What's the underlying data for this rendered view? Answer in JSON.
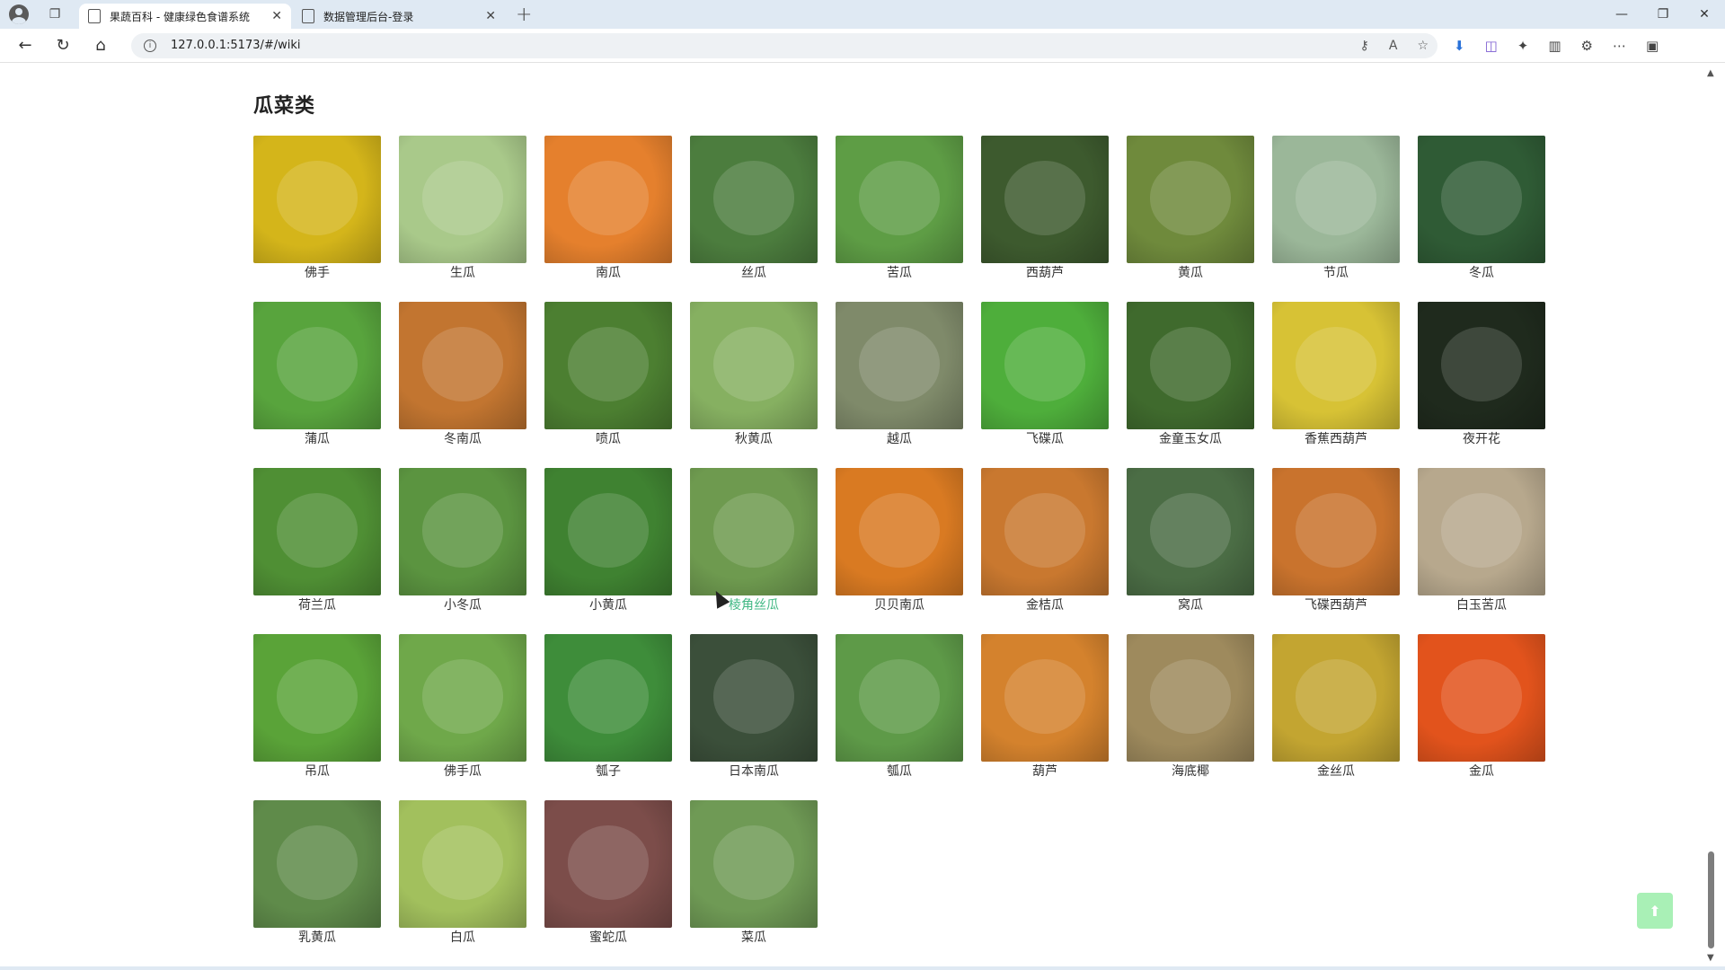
{
  "browser": {
    "tabs": [
      {
        "label": "果蔬百科 - 健康绿色食谱系统",
        "active": true
      },
      {
        "label": "数据管理后台-登录",
        "active": false
      }
    ],
    "url": "127.0.0.1:5173/#/wiki"
  },
  "previous_row_labels": [
    "",
    "",
    ""
  ],
  "section": {
    "title": "瓜菜类"
  },
  "items": [
    {
      "name": "佛手",
      "color": "#d4b51a"
    },
    {
      "name": "生瓜",
      "color": "#a9c98a"
    },
    {
      "name": "南瓜",
      "color": "#e5802d"
    },
    {
      "name": "丝瓜",
      "color": "#4c7d3e"
    },
    {
      "name": "苦瓜",
      "color": "#5e9d45"
    },
    {
      "name": "西葫芦",
      "color": "#3d5a2e"
    },
    {
      "name": "黄瓜",
      "color": "#6f8a3c"
    },
    {
      "name": "节瓜",
      "color": "#9bb799"
    },
    {
      "name": "冬瓜",
      "color": "#2f5b35"
    },
    {
      "name": "蒲瓜",
      "color": "#58a43d"
    },
    {
      "name": "冬南瓜",
      "color": "#c27530"
    },
    {
      "name": "喷瓜",
      "color": "#4c7f31"
    },
    {
      "name": "秋黄瓜",
      "color": "#86b061"
    },
    {
      "name": "越瓜",
      "color": "#7f8a6a"
    },
    {
      "name": "飞碟瓜",
      "color": "#4eae3b"
    },
    {
      "name": "金童玉女瓜",
      "color": "#3f6a2d"
    },
    {
      "name": "香蕉西葫芦",
      "color": "#d7c235"
    },
    {
      "name": "夜开花",
      "color": "#1f2a1d"
    },
    {
      "name": "荷兰瓜",
      "color": "#4f8f34"
    },
    {
      "name": "小冬瓜",
      "color": "#5b9440"
    },
    {
      "name": "小黄瓜",
      "color": "#3f8231"
    },
    {
      "name": "棱角丝瓜",
      "color": "#6e9a4f",
      "hovered": true
    },
    {
      "name": "贝贝南瓜",
      "color": "#d97a22"
    },
    {
      "name": "金桔瓜",
      "color": "#c9782f"
    },
    {
      "name": "窝瓜",
      "color": "#4b6d45"
    },
    {
      "name": "飞碟西葫芦",
      "color": "#c9732d"
    },
    {
      "name": "白玉苦瓜",
      "color": "#b7a88d"
    },
    {
      "name": "吊瓜",
      "color": "#5aa338"
    },
    {
      "name": "佛手瓜",
      "color": "#6fa84a"
    },
    {
      "name": "瓠子",
      "color": "#3e8d3a"
    },
    {
      "name": "日本南瓜",
      "color": "#3b4f3a"
    },
    {
      "name": "瓠瓜",
      "color": "#5e9a48"
    },
    {
      "name": "葫芦",
      "color": "#d4822d"
    },
    {
      "name": "海底椰",
      "color": "#9e8a5d"
    },
    {
      "name": "金丝瓜",
      "color": "#c3a531"
    },
    {
      "name": "金瓜",
      "color": "#e2531c"
    },
    {
      "name": "乳黄瓜",
      "color": "#5f8b4a"
    },
    {
      "name": "白瓜",
      "color": "#a2c05d"
    },
    {
      "name": "蜜蛇瓜",
      "color": "#7c4d4a"
    },
    {
      "name": "菜瓜",
      "color": "#6f9a55"
    }
  ]
}
